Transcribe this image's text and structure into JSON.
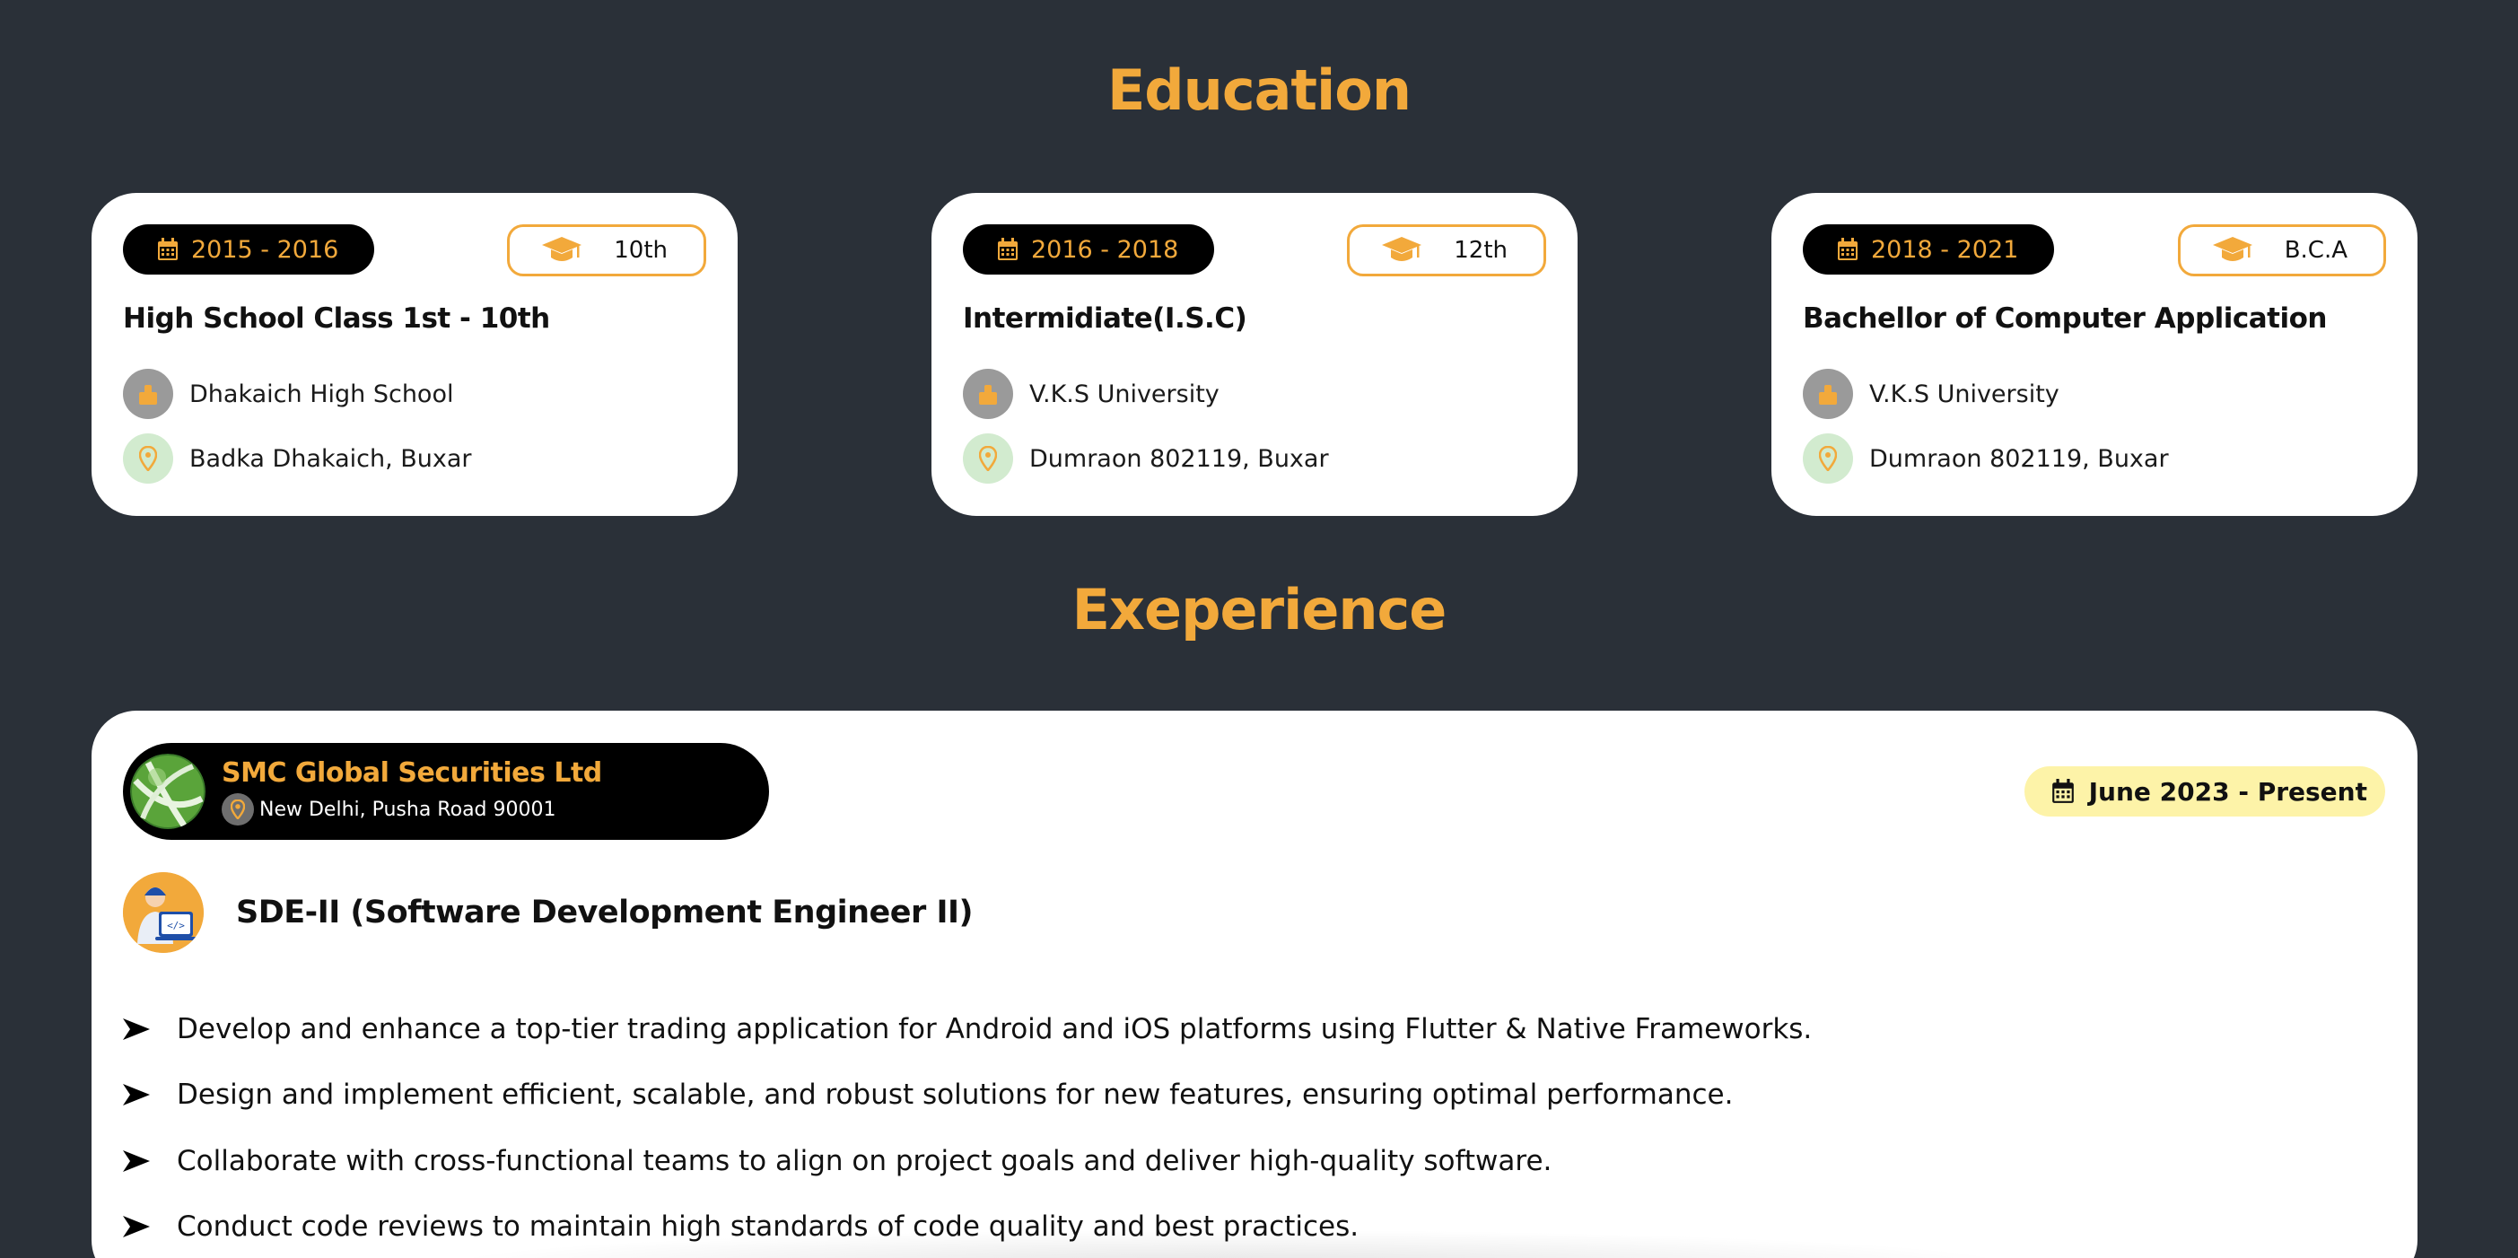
{
  "education": {
    "title": "Education",
    "cards": [
      {
        "years": "2015 - 2016",
        "grade": "10th",
        "heading": "High School Class 1st - 10th",
        "school": "Dhakaich High School",
        "location": "Badka Dhakaich, Buxar"
      },
      {
        "years": "2016 - 2018",
        "grade": "12th",
        "heading": "Intermidiate(I.S.C)",
        "school": "V.K.S University",
        "location": "Dumraon 802119, Buxar"
      },
      {
        "years": "2018 - 2021",
        "grade": "B.C.A",
        "heading": "Bachellor of Computer Application",
        "school": "V.K.S University",
        "location": "Dumraon 802119, Buxar"
      }
    ]
  },
  "experience": {
    "title": "Exeperience",
    "company": "SMC Global Securities Ltd",
    "company_location": "New Delhi, Pusha Road 90001",
    "period": "June 2023 -  Present",
    "role": "SDE-II (Software Development Engineer II)",
    "bullets": [
      "Develop and enhance a top-tier trading application for Android and iOS platforms using Flutter & Native Frameworks.",
      "Design and implement efficient, scalable, and robust solutions for new features, ensuring optimal performance.",
      "Collaborate with cross-functional teams to align on project goals and deliver high-quality software.",
      "Conduct code reviews to maintain high standards of code quality and best practices."
    ]
  },
  "colors": {
    "background": "#2a3038",
    "accent": "#f2a93b",
    "card": "#ffffff",
    "period_bg": "#fdf3a8"
  },
  "icons": [
    "calendar-icon",
    "graduation-cap-icon",
    "school-icon",
    "location-pin-icon",
    "globe-logo-icon",
    "developer-avatar-icon",
    "arrow-bullet-icon"
  ]
}
